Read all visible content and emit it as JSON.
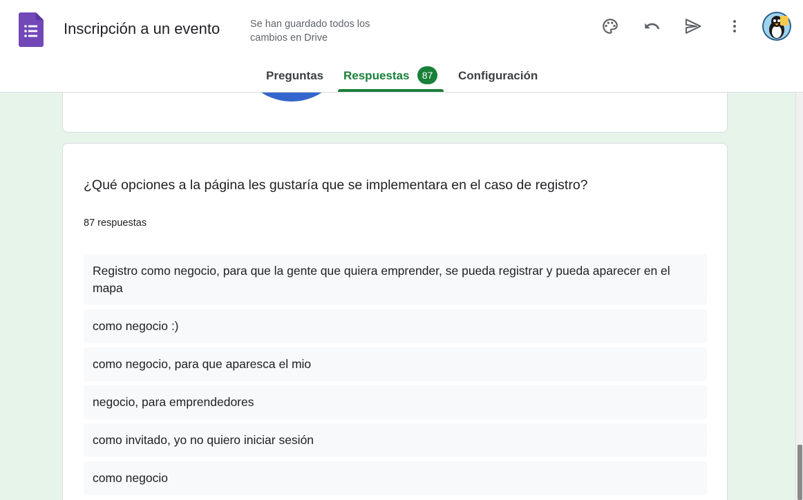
{
  "header": {
    "title": "Inscripción a un evento",
    "save_status": "Se han guardado todos los cambios en Drive",
    "icons": {
      "logo": "forms-logo-icon",
      "palette": "palette-icon",
      "undo": "undo-icon",
      "send": "send-icon",
      "more": "more-vert-icon",
      "avatar": "avatar"
    }
  },
  "tabs": {
    "preguntas": "Preguntas",
    "respuestas": "Respuestas",
    "respuestas_badge": "87",
    "configuracion": "Configuración",
    "active": "Respuestas"
  },
  "question_card": {
    "question": "¿Qué opciones a la página les gustaría que se implementara en el caso de registro?",
    "response_count": "87 respuestas",
    "answers": [
      "Registro como negocio, para que la gente que quiera emprender, se pueda registrar y pueda aparecer en el mapa",
      "como negocio :)",
      "como negocio, para que aparesca el mio",
      "negocio, para emprendedores",
      "como invitado, yo no quiero iniciar sesión",
      "como negocio"
    ]
  },
  "colors": {
    "accent": "#188038",
    "background": "#e6f4ea",
    "forms_purple": "#7248b9",
    "pie_blue": "#3366cc"
  }
}
